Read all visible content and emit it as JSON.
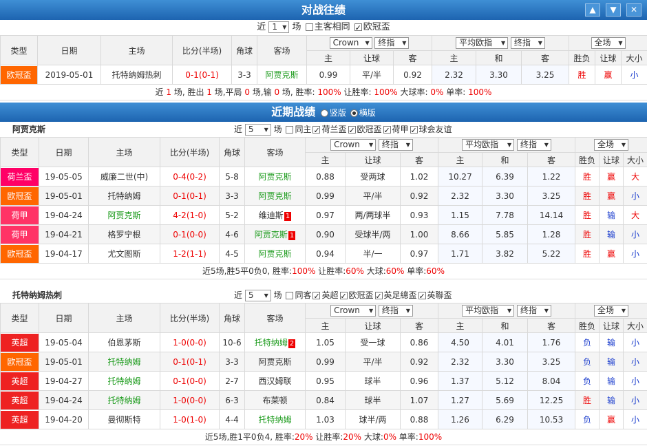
{
  "top_bar": {
    "title": "对战往绩",
    "icons": [
      "arrow-up-icon",
      "arrow-down-icon",
      "close-icon"
    ]
  },
  "h2h_ctrl": {
    "pre": "近",
    "count": "1",
    "post": "场",
    "chk1": "主客相同",
    "chk2": "欧冠盃"
  },
  "cols": {
    "type": "类型",
    "date": "日期",
    "home": "主场",
    "score": "比分(半场)",
    "corner": "角球",
    "away": "客场",
    "crown": "Crown",
    "ou": "终指",
    "avg": "平均欧指",
    "full": "全场",
    "win": "胜负",
    "hand": "让球",
    "bs": "大小",
    "zhu": "主",
    "rang": "让球",
    "ke": "客",
    "he": "和"
  },
  "h2h_rows": [
    {
      "type": "欧冠盃",
      "color": "#f60",
      "date": "2019-05-01",
      "home": "托特纳姆热刺",
      "score": "0-1(0-1)",
      "corner": "3-3",
      "away": "阿贾克斯",
      "o1": "0.99",
      "o2": "平/半",
      "o3": "0.92",
      "e1": "2.32",
      "e2": "3.30",
      "e3": "3.25",
      "w": "胜",
      "r": "赢",
      "d": "小"
    }
  ],
  "h2h_sum": {
    "a": "近 ",
    "b": "1",
    "c": " 场, 胜出 ",
    "d": "1",
    "e": " 场,平局 ",
    "f": "0",
    "g": " 场,输 ",
    "h": "0",
    "i": " 场, 胜率: ",
    "j": "100%",
    "k": " 让胜率: ",
    "l": "100%",
    "m": " 大球率: ",
    "n": "0%",
    "o": " 单率: ",
    "p": "100%"
  },
  "recent_bar": {
    "title": "近期战绩",
    "opt1": "竖版",
    "opt2": "横版"
  },
  "t1": {
    "name": "阿贾克斯",
    "count": "5",
    "chks": [
      "同主",
      "荷兰盃",
      "欧冠盃",
      "荷甲",
      "球会友谊"
    ],
    "rows": [
      {
        "type": "荷兰盃",
        "color": "#f06",
        "date": "19-05-05",
        "home": "威廉二世(中)",
        "hc": "",
        "score": "0-4(0-2)",
        "corner": "5-8",
        "away": "阿贾克斯",
        "ac": "grn",
        "card": "",
        "o1": "0.88",
        "o2": "受两球",
        "o3": "1.02",
        "e1": "10.27",
        "e2": "6.39",
        "e3": "1.22",
        "w": "胜",
        "wc": "red",
        "r": "赢",
        "rc": "red",
        "d": "大",
        "dc": "red"
      },
      {
        "type": "欧冠盃",
        "color": "#f60",
        "date": "19-05-01",
        "home": "托特纳姆",
        "hc": "",
        "score": "0-1(0-1)",
        "corner": "3-3",
        "away": "阿贾克斯",
        "ac": "grn",
        "card": "",
        "o1": "0.99",
        "o2": "平/半",
        "o3": "0.92",
        "e1": "2.32",
        "e2": "3.30",
        "e3": "3.25",
        "w": "胜",
        "wc": "red",
        "r": "赢",
        "rc": "red",
        "d": "小",
        "dc": "blu"
      },
      {
        "type": "荷甲",
        "color": "#f36",
        "date": "19-04-24",
        "home": "阿贾克斯",
        "hc": "grn",
        "score": "4-2(1-0)",
        "corner": "5-2",
        "away": "维迪斯",
        "ac": "",
        "card": "1",
        "o1": "0.97",
        "o2": "两/两球半",
        "o3": "0.93",
        "e1": "1.15",
        "e2": "7.78",
        "e3": "14.14",
        "w": "胜",
        "wc": "red",
        "r": "输",
        "rc": "blu",
        "d": "大",
        "dc": "red"
      },
      {
        "type": "荷甲",
        "color": "#f36",
        "date": "19-04-21",
        "home": "格罗宁根",
        "hc": "",
        "score": "0-1(0-0)",
        "corner": "4-6",
        "away": "阿贾克斯",
        "ac": "grn",
        "card": "1",
        "o1": "0.90",
        "o2": "受球半/两",
        "o3": "1.00",
        "e1": "8.66",
        "e2": "5.85",
        "e3": "1.28",
        "w": "胜",
        "wc": "red",
        "r": "输",
        "rc": "blu",
        "d": "小",
        "dc": "blu"
      },
      {
        "type": "欧冠盃",
        "color": "#f60",
        "date": "19-04-17",
        "home": "尤文图斯",
        "hc": "",
        "score": "1-2(1-1)",
        "corner": "4-5",
        "away": "阿贾克斯",
        "ac": "grn",
        "card": "",
        "o1": "0.94",
        "o2": "半/一",
        "o3": "0.97",
        "e1": "1.71",
        "e2": "3.82",
        "e3": "5.22",
        "w": "胜",
        "wc": "red",
        "r": "赢",
        "rc": "red",
        "d": "小",
        "dc": "blu"
      }
    ],
    "sum": {
      "a": "近5场,胜5平0负0, 胜率:",
      "b": "100%",
      "c": " 让胜率:",
      "d": "60%",
      "e": " 大球:",
      "f": "60%",
      "g": " 单率:",
      "h": "60%"
    }
  },
  "t2": {
    "name": "托特纳姆热刺",
    "count": "5",
    "chks": [
      "同客",
      "英超",
      "欧冠盃",
      "英足總盃",
      "英聯盃"
    ],
    "rows": [
      {
        "type": "英超",
        "color": "#e22",
        "date": "19-05-04",
        "home": "伯恩茅斯",
        "hc": "",
        "score": "1-0(0-0)",
        "corner": "10-6",
        "away": "托特纳姆",
        "ac": "grn",
        "card": "2",
        "o1": "1.05",
        "o2": "受一球",
        "o3": "0.86",
        "e1": "4.50",
        "e2": "4.01",
        "e3": "1.76",
        "w": "负",
        "wc": "blu",
        "r": "输",
        "rc": "blu",
        "d": "小",
        "dc": "blu"
      },
      {
        "type": "欧冠盃",
        "color": "#f60",
        "date": "19-05-01",
        "home": "托特纳姆",
        "hc": "grn",
        "score": "0-1(0-1)",
        "corner": "3-3",
        "away": "阿贾克斯",
        "ac": "",
        "card": "",
        "o1": "0.99",
        "o2": "平/半",
        "o3": "0.92",
        "e1": "2.32",
        "e2": "3.30",
        "e3": "3.25",
        "w": "负",
        "wc": "blu",
        "r": "输",
        "rc": "blu",
        "d": "小",
        "dc": "blu"
      },
      {
        "type": "英超",
        "color": "#e22",
        "date": "19-04-27",
        "home": "托特纳姆",
        "hc": "grn",
        "score": "0-1(0-0)",
        "corner": "2-7",
        "away": "西汉姆联",
        "ac": "",
        "card": "",
        "o1": "0.95",
        "o2": "球半",
        "o3": "0.96",
        "e1": "1.37",
        "e2": "5.12",
        "e3": "8.04",
        "w": "负",
        "wc": "blu",
        "r": "输",
        "rc": "blu",
        "d": "小",
        "dc": "blu"
      },
      {
        "type": "英超",
        "color": "#e22",
        "date": "19-04-24",
        "home": "托特纳姆",
        "hc": "grn",
        "score": "1-0(0-0)",
        "corner": "6-3",
        "away": "布莱顿",
        "ac": "",
        "card": "",
        "o1": "0.84",
        "o2": "球半",
        "o3": "1.07",
        "e1": "1.27",
        "e2": "5.69",
        "e3": "12.25",
        "w": "胜",
        "wc": "red",
        "r": "输",
        "rc": "blu",
        "d": "小",
        "dc": "blu"
      },
      {
        "type": "英超",
        "color": "#e22",
        "date": "19-04-20",
        "home": "曼彻斯特",
        "hc": "",
        "score": "1-0(1-0)",
        "corner": "4-4",
        "away": "托特纳姆",
        "ac": "grn",
        "card": "",
        "o1": "1.03",
        "o2": "球半/两",
        "o3": "0.88",
        "e1": "1.26",
        "e2": "6.29",
        "e3": "10.53",
        "w": "负",
        "wc": "blu",
        "r": "赢",
        "rc": "red",
        "d": "小",
        "dc": "blu"
      }
    ],
    "sum": {
      "a": "近5场,胜1平0负4, 胜率:",
      "b": "20%",
      "c": " 让胜率:",
      "d": "20%",
      "e": " 大球:",
      "f": "0%",
      "g": " 单率:",
      "h": "100%"
    }
  }
}
